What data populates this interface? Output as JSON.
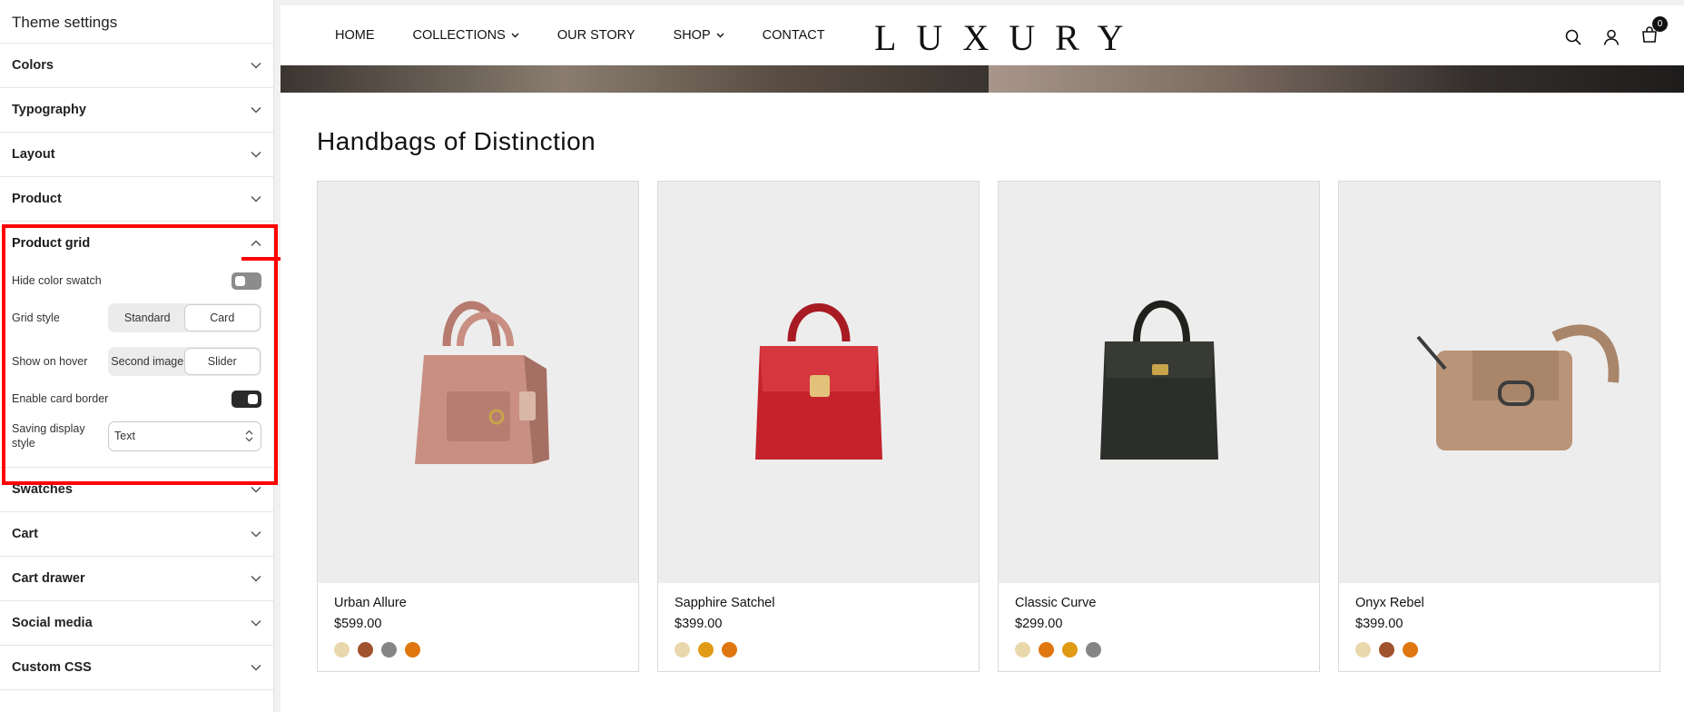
{
  "sidebar": {
    "title": "Theme settings",
    "top_sections": [
      "Colors",
      "Typography",
      "Layout",
      "Product"
    ],
    "product_grid": {
      "title": "Product grid",
      "hide_color_swatch": {
        "label": "Hide color swatch",
        "enabled": false
      },
      "grid_style": {
        "label": "Grid style",
        "options": [
          "Standard",
          "Card"
        ],
        "selected": "Card"
      },
      "show_on_hover": {
        "label": "Show on hover",
        "options": [
          "Second image",
          "Slider"
        ],
        "selected": "Slider"
      },
      "enable_card_border": {
        "label": "Enable card border",
        "enabled": true
      },
      "saving_display_style": {
        "label": "Saving display style",
        "value": "Text"
      }
    },
    "bottom_sections": [
      "Swatches",
      "Cart",
      "Cart drawer",
      "Social media",
      "Custom CSS"
    ]
  },
  "store": {
    "nav": [
      "HOME",
      "COLLECTIONS",
      "OUR STORY",
      "SHOP",
      "CONTACT"
    ],
    "logo": "LUXURY",
    "cart_count": "0"
  },
  "collection": {
    "title": "Handbags of Distinction",
    "products": [
      {
        "name": "Urban Allure",
        "price": "$599.00",
        "swatches": [
          "#ead8ad",
          "#a0522d",
          "#858585",
          "#e0760f"
        ],
        "bag_color": "#c98f82"
      },
      {
        "name": "Sapphire Satchel",
        "price": "$399.00",
        "swatches": [
          "#ead8ad",
          "#e09a14",
          "#e0760f"
        ],
        "bag_color": "#c4232c"
      },
      {
        "name": "Classic Curve",
        "price": "$299.00",
        "swatches": [
          "#ead8ad",
          "#e0760f",
          "#e09a14",
          "#858585"
        ],
        "bag_color": "#2c2e29"
      },
      {
        "name": "Onyx Rebel",
        "price": "$399.00",
        "swatches": [
          "#ead8ad",
          "#a0522d",
          "#e0760f"
        ],
        "bag_color": "#b99478"
      }
    ]
  }
}
